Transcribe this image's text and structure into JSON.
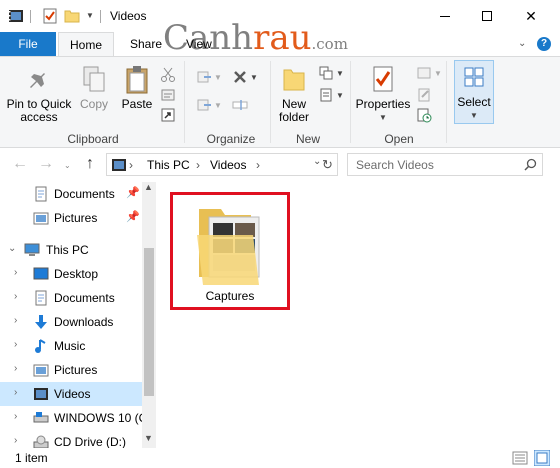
{
  "window": {
    "title": "Videos",
    "minimize_icon": "minimize-icon",
    "maximize_icon": "maximize-icon",
    "close_icon": "close-icon"
  },
  "watermark": {
    "brand_a": "Canh",
    "brand_b": "rau",
    "domain": ".com"
  },
  "tabs": {
    "file": "File",
    "home": "Home",
    "share": "Share",
    "view": "View"
  },
  "ribbon": {
    "clipboard": {
      "label": "Clipboard",
      "pin_to_quick_access": [
        "Pin to Quick",
        "access"
      ],
      "copy": "Copy",
      "paste": "Paste"
    },
    "organize": {
      "label": "Organize"
    },
    "new": {
      "label": "New",
      "new_folder": [
        "New",
        "folder"
      ]
    },
    "open": {
      "label": "Open",
      "properties": "Properties"
    },
    "select": {
      "label": "Select"
    }
  },
  "address": {
    "path": [
      "This PC",
      "Videos"
    ],
    "search_placeholder": "Search Videos"
  },
  "nav_pane": {
    "items": [
      {
        "label": "Documents",
        "pinned": true
      },
      {
        "label": "Pictures",
        "pinned": true
      },
      {
        "label": "This PC",
        "expanded": true
      },
      {
        "label": "Desktop"
      },
      {
        "label": "Documents"
      },
      {
        "label": "Downloads"
      },
      {
        "label": "Music"
      },
      {
        "label": "Pictures"
      },
      {
        "label": "Videos",
        "selected": true
      },
      {
        "label": "WINDOWS 10 (C"
      },
      {
        "label": "CD Drive (D:)"
      }
    ]
  },
  "content": {
    "items": [
      {
        "name": "Captures",
        "type": "folder"
      }
    ]
  },
  "status": {
    "item_count": "1 item"
  },
  "colors": {
    "accent": "#1979ca",
    "selection": "#cce8ff",
    "highlight_box": "#e01020",
    "folder": "#f8d775"
  }
}
